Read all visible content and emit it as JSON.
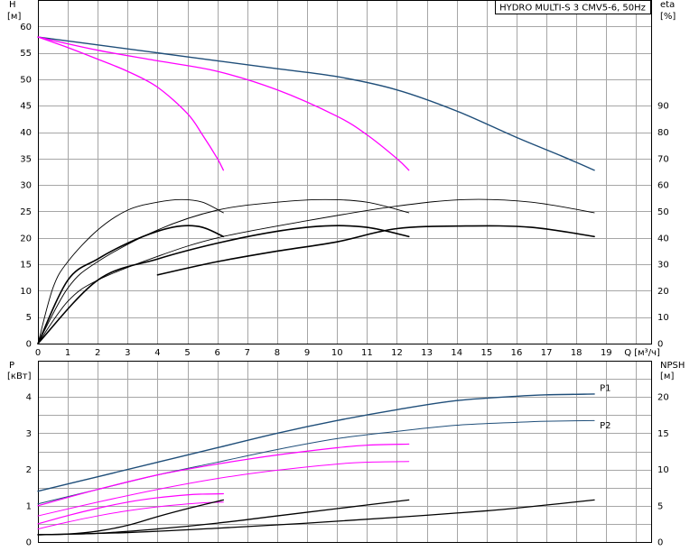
{
  "chart_data": [
    {
      "type": "line",
      "title": "HYDRO MULTI-S 3 CMV5-6, 50Hz",
      "x_unit_label": "Q [м³/ч]",
      "x_ticks": [
        "0",
        "1",
        "2",
        "3",
        "4",
        "5",
        "6",
        "7",
        "8",
        "9",
        "10",
        "11",
        "12",
        "13",
        "14",
        "15",
        "16",
        "17",
        "18",
        "19"
      ],
      "xlim": [
        0,
        20.5
      ],
      "left_axis": {
        "label_line1": "H",
        "label_line2": "[м]",
        "ylim": [
          0,
          65
        ],
        "ticks": [
          "0",
          "5",
          "10",
          "15",
          "20",
          "25",
          "30",
          "35",
          "40",
          "45",
          "50",
          "55",
          "60"
        ]
      },
      "right_axis": {
        "label_line1": "eta",
        "label_line2": "[%]",
        "ylim": [
          0,
          130
        ],
        "ticks": [
          "0",
          "10",
          "20",
          "30",
          "40",
          "50",
          "60",
          "70",
          "80",
          "90"
        ]
      },
      "series": [
        {
          "axis": "left",
          "color": "#1f4e79",
          "width": 1.4,
          "x": [
            0,
            2,
            4,
            6,
            8,
            10,
            12,
            14,
            16,
            17.5,
            18.6
          ],
          "y": [
            58,
            56.5,
            55,
            53.5,
            52,
            50.5,
            48,
            44,
            39,
            35.5,
            32.8
          ]
        },
        {
          "axis": "left",
          "color": "#ff00ff",
          "width": 1.3,
          "x": [
            0,
            2,
            4,
            6,
            8,
            10,
            11,
            12,
            12.4
          ],
          "y": [
            58,
            55.5,
            53.5,
            51.5,
            48,
            43,
            39.5,
            35,
            32.8
          ]
        },
        {
          "axis": "left",
          "color": "#ff00ff",
          "width": 1.3,
          "x": [
            0,
            1,
            2,
            3,
            4,
            5,
            5.5,
            6,
            6.2
          ],
          "y": [
            58,
            56,
            53.8,
            51.5,
            48.5,
            43.5,
            39.5,
            35,
            32.8
          ]
        },
        {
          "axis": "right",
          "color": "#000000",
          "width": 0.9,
          "x": [
            0,
            0.5,
            1,
            2,
            3,
            4,
            4.8,
            5.5,
            6.2
          ],
          "y": [
            0,
            21,
            31,
            43,
            50.5,
            53.5,
            54.5,
            53.5,
            49.5
          ]
        },
        {
          "axis": "right",
          "color": "#000000",
          "width": 1.6,
          "x": [
            0,
            1,
            2,
            3,
            4,
            4.8,
            5.5,
            6.2
          ],
          "y": [
            0,
            24,
            32,
            38,
            42.5,
            44.5,
            44,
            40.5
          ]
        },
        {
          "axis": "right",
          "color": "#000000",
          "width": 0.9,
          "x": [
            0,
            1,
            2,
            4,
            6,
            8,
            9.6,
            11,
            12.4
          ],
          "y": [
            0,
            21,
            31,
            43,
            50.5,
            53.5,
            54.5,
            53.5,
            49.5
          ]
        },
        {
          "axis": "right",
          "color": "#000000",
          "width": 1.6,
          "x": [
            0,
            2,
            4,
            6,
            8,
            9.6,
            11,
            12.4
          ],
          "y": [
            0,
            24,
            32,
            38,
            42.5,
            44.5,
            44,
            40.5
          ]
        },
        {
          "axis": "right",
          "color": "#000000",
          "width": 0.9,
          "x": [
            0,
            1,
            2,
            4,
            6,
            9,
            12,
            14.3,
            16.5,
            18.6
          ],
          "y": [
            0,
            16,
            24,
            33,
            40,
            46.5,
            52,
            54.5,
            53.5,
            49.5
          ]
        },
        {
          "axis": "right",
          "color": "#000000",
          "width": 1.6,
          "x": [
            4,
            6,
            8,
            10,
            12,
            14.3,
            16.5,
            18.6
          ],
          "y": [
            26,
            31,
            35,
            38.5,
            43.5,
            44.5,
            44,
            40.5
          ]
        }
      ]
    },
    {
      "type": "line",
      "x_ticks": [
        "0",
        "1",
        "2",
        "3",
        "4",
        "5",
        "6",
        "7",
        "8",
        "9",
        "10",
        "11",
        "12",
        "13",
        "14",
        "15",
        "16",
        "17",
        "18",
        "19"
      ],
      "xlim": [
        0,
        20.5
      ],
      "left_axis": {
        "label_line1": "P",
        "label_line2": "[кВт]",
        "ylim": [
          0,
          5
        ],
        "ticks": [
          "0",
          "1",
          "2",
          "3",
          "4"
        ]
      },
      "right_axis": {
        "label_line1": "NPSH",
        "label_line2": "[м]",
        "ylim": [
          0,
          25
        ],
        "ticks": [
          "0",
          "5",
          "10",
          "15",
          "20"
        ]
      },
      "series": [
        {
          "name": "P1",
          "axis": "left",
          "color": "#1f4e79",
          "width": 1.4,
          "x": [
            0,
            2,
            4,
            6,
            8,
            10,
            12,
            14,
            16,
            17,
            18.6
          ],
          "y": [
            1.4,
            1.8,
            2.2,
            2.6,
            3.0,
            3.35,
            3.65,
            3.9,
            4.02,
            4.06,
            4.08
          ]
        },
        {
          "name": "P2",
          "axis": "left",
          "color": "#1f4e79",
          "width": 1.0,
          "x": [
            0,
            2,
            4,
            6,
            8,
            10,
            12,
            14,
            16,
            17,
            18.6
          ],
          "y": [
            1.05,
            1.45,
            1.85,
            2.2,
            2.55,
            2.85,
            3.05,
            3.22,
            3.3,
            3.33,
            3.35
          ]
        },
        {
          "axis": "left",
          "color": "#ff00ff",
          "width": 1.2,
          "x": [
            0,
            2,
            4,
            6,
            8,
            10,
            11,
            12.4
          ],
          "y": [
            1.0,
            1.45,
            1.85,
            2.15,
            2.4,
            2.6,
            2.67,
            2.7
          ]
        },
        {
          "axis": "left",
          "color": "#ff00ff",
          "width": 1.0,
          "x": [
            0,
            2,
            4,
            6,
            8,
            10,
            11,
            12.4
          ],
          "y": [
            0.72,
            1.1,
            1.45,
            1.75,
            1.98,
            2.15,
            2.2,
            2.22
          ]
        },
        {
          "axis": "left",
          "color": "#ff00ff",
          "width": 1.2,
          "x": [
            0,
            1,
            2,
            3,
            4,
            5,
            5.5,
            6.2
          ],
          "y": [
            0.5,
            0.73,
            0.93,
            1.1,
            1.22,
            1.3,
            1.32,
            1.33
          ]
        },
        {
          "axis": "left",
          "color": "#ff00ff",
          "width": 1.0,
          "x": [
            0,
            1,
            2,
            3,
            4,
            5,
            5.5,
            6.2
          ],
          "y": [
            0.36,
            0.55,
            0.72,
            0.86,
            0.97,
            1.05,
            1.08,
            1.1
          ]
        },
        {
          "axis": "right",
          "color": "#000000",
          "width": 1.3,
          "x": [
            0,
            1,
            2,
            3,
            4,
            5,
            6.2
          ],
          "y": [
            1,
            1.1,
            1.5,
            2.3,
            3.5,
            4.6,
            5.8
          ]
        },
        {
          "axis": "right",
          "color": "#000000",
          "width": 1.3,
          "x": [
            0,
            2,
            4,
            6,
            8,
            10,
            12.4
          ],
          "y": [
            1,
            1.2,
            1.8,
            2.6,
            3.6,
            4.6,
            5.8
          ]
        },
        {
          "axis": "right",
          "color": "#000000",
          "width": 1.3,
          "x": [
            0,
            3,
            6,
            9,
            12,
            15,
            17,
            18.6
          ],
          "y": [
            1,
            1.3,
            1.9,
            2.6,
            3.4,
            4.3,
            5.1,
            5.8
          ]
        }
      ],
      "series_labels": [
        {
          "text": "P1",
          "color": "#1f4e79",
          "x": 18.6,
          "y": 4.25
        },
        {
          "text": "P2",
          "color": "#1f4e79",
          "x": 18.6,
          "y": 3.22
        }
      ]
    }
  ]
}
